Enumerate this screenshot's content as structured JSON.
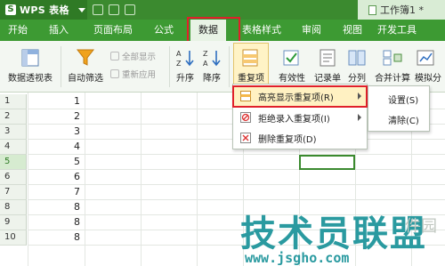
{
  "app": {
    "name": "WPS 表格",
    "logo_letter": "S",
    "doc_title": "工作簿1 *"
  },
  "menu": {
    "tabs": [
      "开始",
      "插入",
      "页面布局",
      "公式",
      "数据",
      "表格样式",
      "审阅",
      "视图",
      "开发工具"
    ],
    "active": "数据"
  },
  "ribbon": {
    "pivot": "数据透视表",
    "autofilter": "自动筛选",
    "show_all": "全部显示",
    "reapply": "重新应用",
    "asc": "升序",
    "desc": "降序",
    "duplicates": "重复项",
    "validity": "有效性",
    "records": "记录单",
    "split": "分列",
    "consolidate": "合并计算",
    "simulate": "模拟分"
  },
  "sheet": {
    "row_numbers": [
      "1",
      "2",
      "3",
      "4",
      "5",
      "6",
      "7",
      "8",
      "9",
      "10"
    ],
    "values": [
      "1",
      "2",
      "3",
      "4",
      "5",
      "6",
      "7",
      "8",
      "8",
      "8"
    ],
    "selected_row": "5"
  },
  "dup_menu": {
    "items": [
      "高亮显示重复项(R)",
      "拒绝录入重复项(I)",
      "删除重复项(D)"
    ]
  },
  "sub_menu": {
    "items": [
      "设置(S)",
      "清除(C)"
    ]
  },
  "watermark": {
    "text": "技术员联盟",
    "url": "www.jsgho.com",
    "ghost": "件园"
  },
  "colors": {
    "brand": "#3b8a2f",
    "menubar": "#3d9a33",
    "highlight_frame": "#e0202a",
    "hover": "#fff1c2"
  }
}
